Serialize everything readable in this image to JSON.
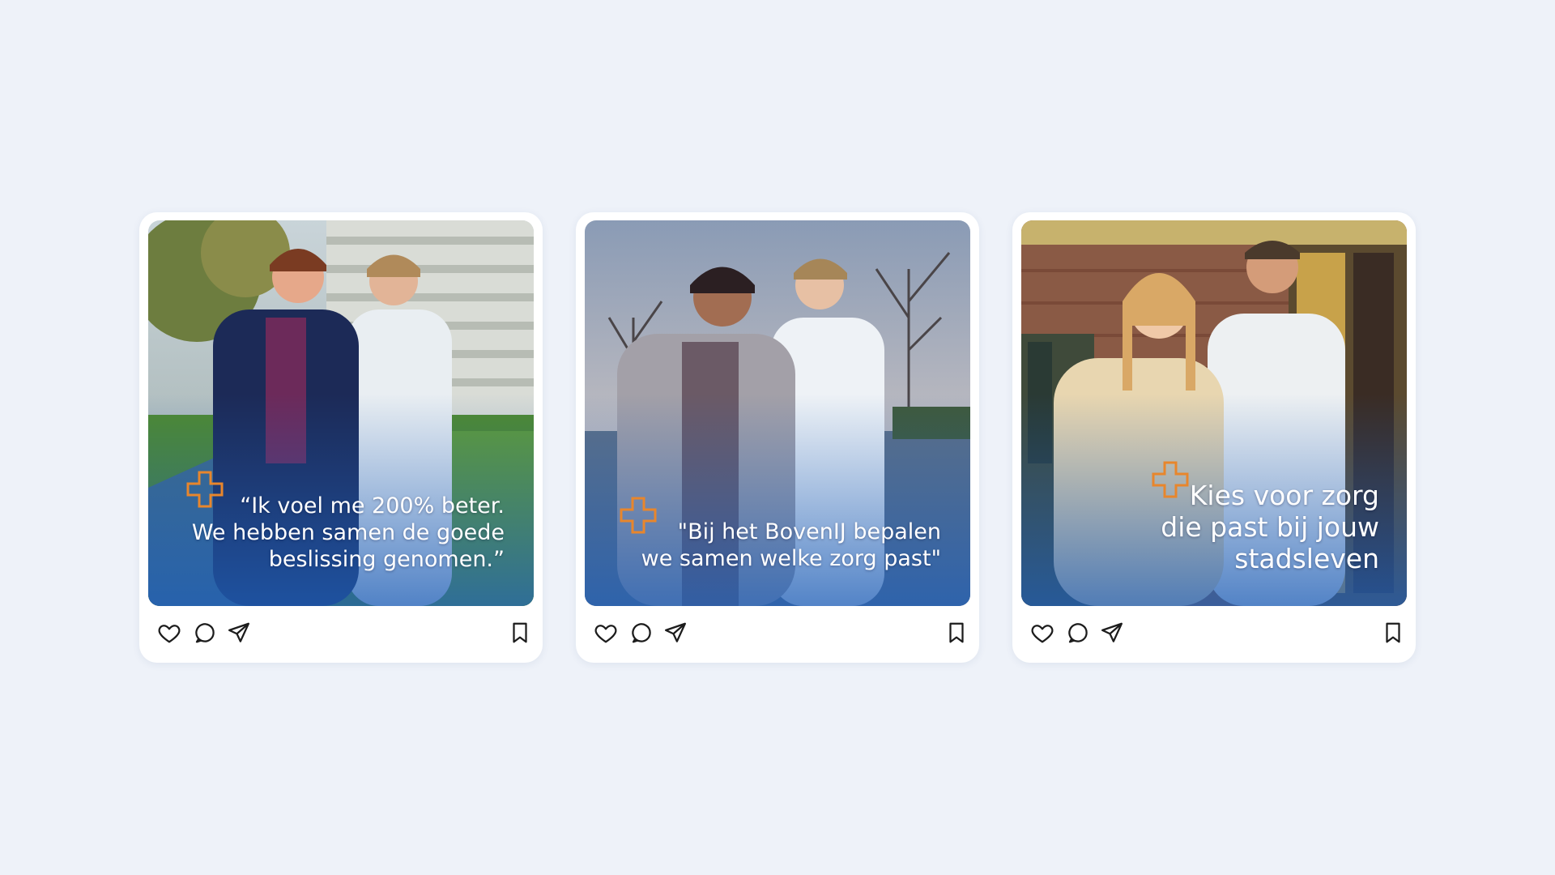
{
  "posts": [
    {
      "id": "post-1",
      "quote_lines": [
        "“Ik voel me 200% beter.",
        "We hebben samen de goede",
        "beslissing genomen.”"
      ],
      "scene": "street"
    },
    {
      "id": "post-2",
      "quote_lines": [
        "\"Bij het BovenIJ bepalen",
        "we samen welke zorg past\""
      ],
      "scene": "canal"
    },
    {
      "id": "post-3",
      "quote_lines": [
        "Kies voor zorg",
        "die past bij jouw",
        "stadsleven"
      ],
      "scene": "brick"
    }
  ],
  "colors": {
    "background": "#eef2f9",
    "card": "#ffffff",
    "accent_orange": "#e8862c",
    "overlay_blue": "#1f5fb8",
    "icon": "#1c1c1c"
  },
  "icons": [
    "heart-icon",
    "comment-icon",
    "send-icon",
    "bookmark-icon"
  ]
}
